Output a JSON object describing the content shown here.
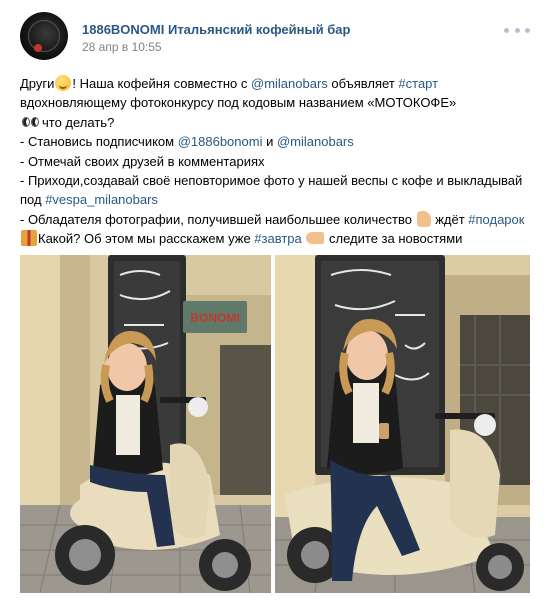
{
  "post": {
    "author": "1886BONOMI Итальянский кофейный бар",
    "date": "28 апр в 10:55"
  },
  "text": {
    "l1_a": "Други",
    "l1_b": "! Наша кофейня совместно с ",
    "l1_mention": "@milanobars",
    "l1_c": " объявляет ",
    "l1_tag": "#старт",
    "l2": "вдохновляющему фотоконкурсу под кодовым названием «МОТОКОФЕ»",
    "l3": "что делать?",
    "l4_a": "- Становись подписчиком ",
    "l4_m1": "@1886bonomi",
    "l4_b": " и ",
    "l4_m2": "@milanobars",
    "l5": "- Отмечай своих друзей в комментариях",
    "l6": "- Приходи,создавай своё неповторимое фото у нашей веспы с кофе и выкладывай",
    "l7_a": "под ",
    "l7_tag": "#vespa_milanobars",
    "l8_a": "- Обладателя фотографии, получившей наибольшее количество ",
    "l8_b": " ждёт ",
    "l8_tag": "#подарок",
    "l9_a": "Какой? Об этом мы расскажем уже ",
    "l9_tag": "#завтра",
    "l9_b": " следите за новостями"
  },
  "photos": {
    "sign_text": "BONOMI"
  },
  "icons": [
    "avatar-logo",
    "more-icon",
    "smile-emoji",
    "eyes-emoji",
    "thumbs-up-emoji",
    "gift-emoji",
    "pointing-right-emoji"
  ],
  "colors": {
    "link": "#2a5885",
    "date": "#828282",
    "menu_dots": "#b8c1cc"
  }
}
